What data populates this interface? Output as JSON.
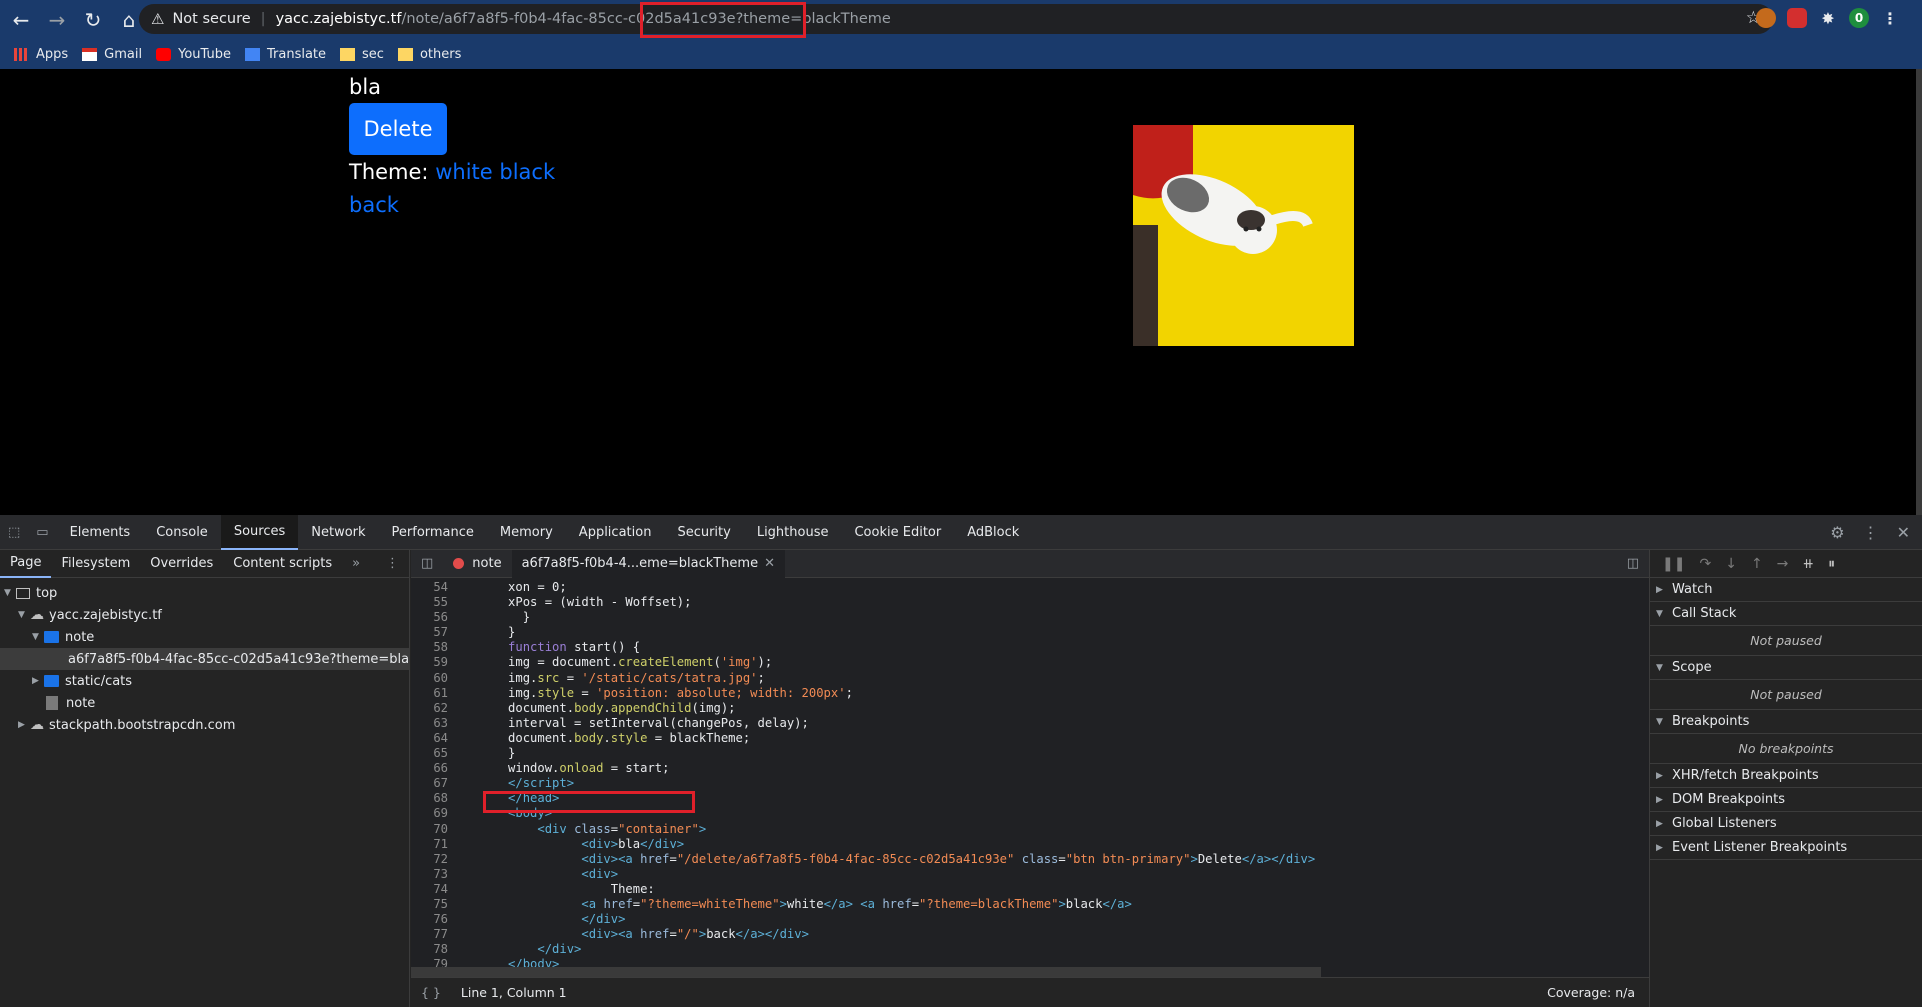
{
  "browser": {
    "security_label": "Not secure",
    "url_host": "yacc.zajebistyc.tf",
    "url_path": "/note/a6f7a8f5-f0b4-4fac-85cc-c02d5a41c93e",
    "url_query": "?theme=blackTheme",
    "extension_badge": "0"
  },
  "bookmarks": [
    {
      "label": "Apps",
      "icon": "apps-grid-icon"
    },
    {
      "label": "Gmail",
      "icon": "gmail-icon"
    },
    {
      "label": "YouTube",
      "icon": "youtube-icon"
    },
    {
      "label": "Translate",
      "icon": "translate-icon"
    },
    {
      "label": "sec",
      "icon": "folder-icon"
    },
    {
      "label": "others",
      "icon": "folder-icon"
    }
  ],
  "page": {
    "note_text": "bla",
    "delete_label": "Delete",
    "theme_label": "Theme:",
    "white_label": "white",
    "black_label": "black",
    "back_label": "back"
  },
  "devtools": {
    "tabs": [
      "Elements",
      "Console",
      "Sources",
      "Network",
      "Performance",
      "Memory",
      "Application",
      "Security",
      "Lighthouse",
      "Cookie Editor",
      "AdBlock"
    ],
    "active_tab": "Sources",
    "nav_tabs": [
      "Page",
      "Filesystem",
      "Overrides",
      "Content scripts"
    ],
    "tree": {
      "top": "top",
      "host": "yacc.zajebistyc.tf",
      "note_folder": "note",
      "selected_file": "a6f7a8f5-f0b4-4fac-85cc-c02d5a41c93e?theme=blackTheme",
      "static_folder": "static/cats",
      "note_file": "note",
      "cdn": "stackpath.bootstrapcdn.com"
    },
    "editor_tabs": [
      "note",
      "a6f7a8f5-f0b4-4...eme=blackTheme"
    ],
    "status_position": "Line 1, Column 1",
    "coverage": "Coverage: n/a",
    "debugger": {
      "watch": "Watch",
      "call_stack": "Call Stack",
      "not_paused_1": "Not paused",
      "scope": "Scope",
      "not_paused_2": "Not paused",
      "breakpoints": "Breakpoints",
      "no_breakpoints": "No breakpoints",
      "xhr": "XHR/fetch Breakpoints",
      "dom": "DOM Breakpoints",
      "global": "Global Listeners",
      "event": "Event Listener Breakpoints"
    },
    "code_lines": [
      {
        "n": "54",
        "html": "      xon = 0;"
      },
      {
        "n": "55",
        "html": "      xPos = (width - Woffset);"
      },
      {
        "n": "56",
        "html": "        }"
      },
      {
        "n": "57",
        "html": "      }"
      },
      {
        "n": "58",
        "html": "      <span class='k'>function</span> start() {"
      },
      {
        "n": "59",
        "html": "      img = document.<span class='f'>createElement</span>(<span class='s'>'img'</span>);"
      },
      {
        "n": "60",
        "html": "      img.<span class='f'>src</span> = <span class='s'>'/static/cats/tatra.jpg'</span>;"
      },
      {
        "n": "61",
        "html": "      img.<span class='f'>style</span> = <span class='s'>'position: absolute; width: 200px'</span>;"
      },
      {
        "n": "62",
        "html": "      document.<span class='f'>body</span>.<span class='f'>appendChild</span>(img);"
      },
      {
        "n": "63",
        "html": "      interval = setInterval(changePos, delay);"
      },
      {
        "n": "64",
        "html": "      document.<span class='f'>body</span>.<span class='f'>style</span> = blackTheme;"
      },
      {
        "n": "65",
        "html": "      }"
      },
      {
        "n": "66",
        "html": "      window.<span class='f'>onload</span> = start;"
      },
      {
        "n": "67",
        "html": "      <span class='t'>&lt;/script&gt;</span>"
      },
      {
        "n": "68",
        "html": "      <span class='t'>&lt;/head&gt;</span>"
      },
      {
        "n": "69",
        "html": "      <span class='t'>&lt;body&gt;</span>"
      },
      {
        "n": "70",
        "html": "          <span class='t'>&lt;div</span> <span class='a'>class</span>=<span class='s'>\"container\"</span><span class='t'>&gt;</span>"
      },
      {
        "n": "71",
        "html": "                <span class='t'>&lt;div&gt;</span>bla<span class='t'>&lt;/div&gt;</span>"
      },
      {
        "n": "72",
        "html": "                <span class='t'>&lt;div&gt;&lt;a</span> <span class='a'>href</span>=<span class='s'>\"/delete/a6f7a8f5-f0b4-4fac-85cc-c02d5a41c93e\"</span> <span class='a'>class</span>=<span class='s'>\"btn btn-primary\"</span><span class='t'>&gt;</span>Delete<span class='t'>&lt;/a&gt;&lt;/div&gt;</span>"
      },
      {
        "n": "73",
        "html": "                <span class='t'>&lt;div&gt;</span>"
      },
      {
        "n": "74",
        "html": "                    Theme:"
      },
      {
        "n": "75",
        "html": "                <span class='t'>&lt;a</span> <span class='a'>href</span>=<span class='s'>\"?theme=whiteTheme\"</span><span class='t'>&gt;</span>white<span class='t'>&lt;/a&gt;</span> <span class='t'>&lt;a</span> <span class='a'>href</span>=<span class='s'>\"?theme=blackTheme\"</span><span class='t'>&gt;</span>black<span class='t'>&lt;/a&gt;</span>"
      },
      {
        "n": "76",
        "html": "                <span class='t'>&lt;/div&gt;</span>"
      },
      {
        "n": "77",
        "html": "                <span class='t'>&lt;div&gt;&lt;a</span> <span class='a'>href</span>=<span class='s'>\"/\"</span><span class='t'>&gt;</span>back<span class='t'>&lt;/a&gt;&lt;/div&gt;</span>"
      },
      {
        "n": "78",
        "html": "          <span class='t'>&lt;/div&gt;</span>"
      },
      {
        "n": "79",
        "html": "      <span class='t'>&lt;/body&gt;</span>"
      }
    ]
  }
}
